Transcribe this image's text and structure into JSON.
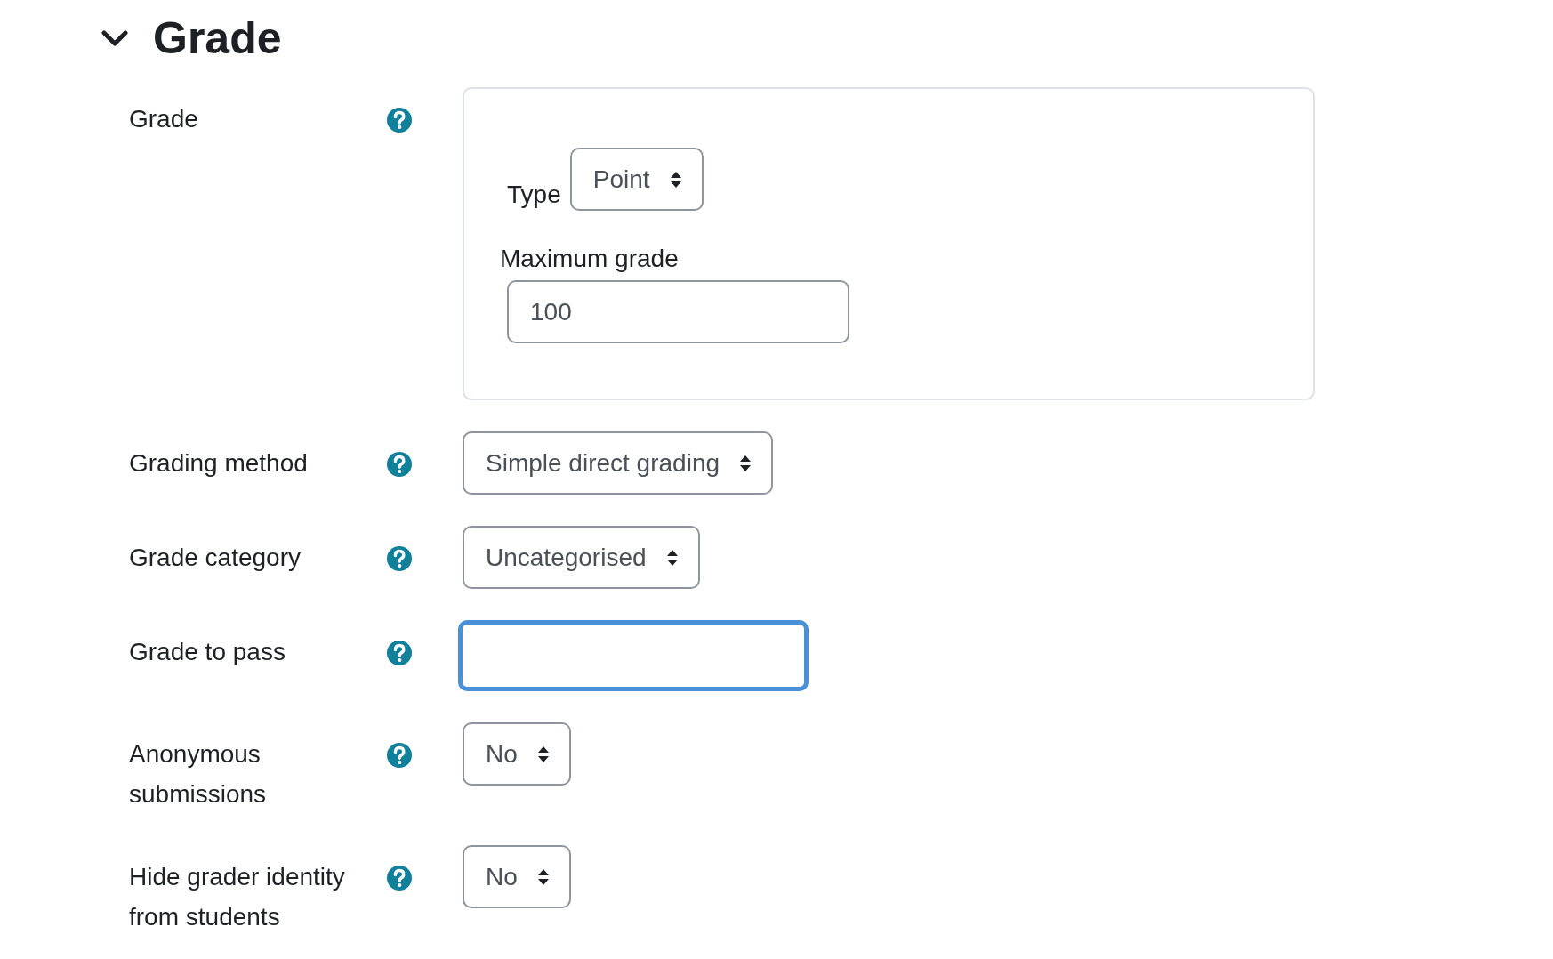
{
  "section": {
    "title": "Grade",
    "expanded": true
  },
  "fields": [
    {
      "kind": "grade_group",
      "label": "Grade",
      "type_label": "Type",
      "type_value": "Point",
      "max_label": "Maximum grade",
      "max_value": "100"
    },
    {
      "kind": "select",
      "label": "Grading method",
      "value": "Simple direct grading"
    },
    {
      "kind": "select",
      "label": "Grade category",
      "value": "Uncategorised"
    },
    {
      "kind": "text",
      "label": "Grade to pass",
      "focused": true
    },
    {
      "kind": "select",
      "label": "Anonymous submissions",
      "value": "No"
    },
    {
      "kind": "select",
      "label": "Hide grader identity from students",
      "value": "No"
    }
  ]
}
